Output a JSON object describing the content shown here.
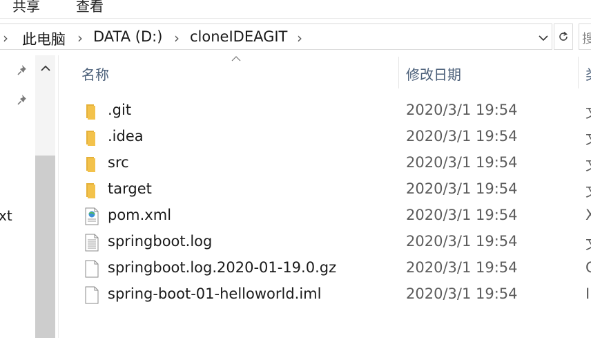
{
  "ribbon": {
    "tabs": [
      "共享",
      "查看"
    ]
  },
  "address": {
    "root_chevron": "›",
    "crumbs": [
      "此电脑",
      "DATA (D:)",
      "cloneIDEAGIT"
    ],
    "separator": "›",
    "search_peek": "搜"
  },
  "navpane": {
    "clipped_text": "xt"
  },
  "columns": {
    "name": "名称",
    "date": "修改日期",
    "type": "类"
  },
  "files": [
    {
      "name": ".git",
      "date": "2020/3/1 19:54",
      "type": "文",
      "icon": "folder-icon"
    },
    {
      "name": ".idea",
      "date": "2020/3/1 19:54",
      "type": "文",
      "icon": "folder-icon"
    },
    {
      "name": "src",
      "date": "2020/3/1 19:54",
      "type": "文",
      "icon": "folder-icon"
    },
    {
      "name": "target",
      "date": "2020/3/1 19:54",
      "type": "文",
      "icon": "folder-icon"
    },
    {
      "name": "pom.xml",
      "date": "2020/3/1 19:54",
      "type": "X",
      "icon": "xml-file-icon"
    },
    {
      "name": "springboot.log",
      "date": "2020/3/1 19:54",
      "type": "文",
      "icon": "text-file-icon"
    },
    {
      "name": "springboot.log.2020-01-19.0.gz",
      "date": "2020/3/1 19:54",
      "type": "G",
      "icon": "blank-file-icon"
    },
    {
      "name": "spring-boot-01-helloworld.iml",
      "date": "2020/3/1 19:54",
      "type": "I",
      "icon": "blank-file-icon"
    }
  ],
  "colors": {
    "folder": "#f3c24b",
    "header_text": "#4c607a",
    "secondary_text": "#5c5c5c"
  }
}
